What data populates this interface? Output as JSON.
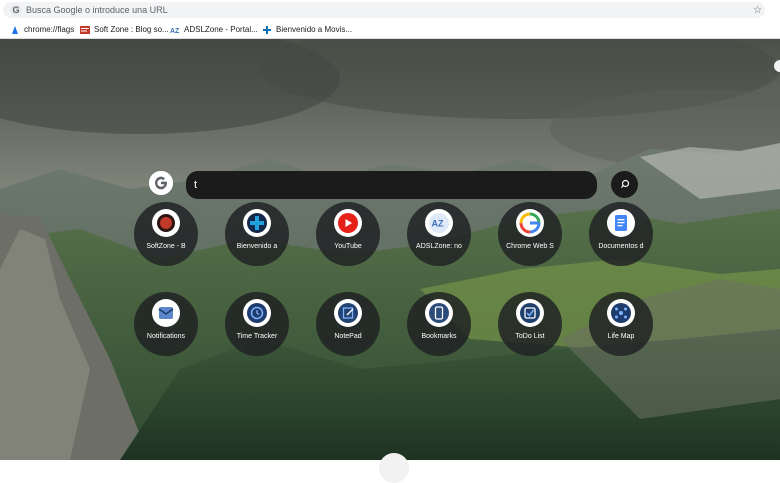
{
  "omnibox": {
    "placeholder": "Busca Google o introduce una URL",
    "icon": "google-g-icon"
  },
  "bookmarks": [
    {
      "label": "chrome://flags",
      "icon": "chrome-flags-icon",
      "color": "#1a73e8"
    },
    {
      "label": "Soft Zone : Blog so...",
      "icon": "softzone-icon",
      "color": "#c0392b"
    },
    {
      "label": "ADSLZone - Portal...",
      "icon": "adslzone-icon",
      "color": "#3d6fb6"
    },
    {
      "label": "Bienvenido a Movis...",
      "icon": "movistar-icon",
      "color": "#0b6fb8"
    }
  ],
  "search": {
    "value": "t"
  },
  "shortcuts": [
    {
      "label": "SoftZone - B",
      "icon": "softzone-icon",
      "color": "#c0392b"
    },
    {
      "label": "Bienvenido a",
      "icon": "movistar-icon",
      "color": "#0b6fb8"
    },
    {
      "label": "YouTube",
      "icon": "youtube-icon",
      "color": "#e62117"
    },
    {
      "label": "ADSLZone: no",
      "icon": "adslzone-icon",
      "color": "#3d6fb6"
    },
    {
      "label": "Chrome Web S",
      "icon": "chrome-web-store-icon",
      "color": "#4285f4"
    },
    {
      "label": "Documentos d",
      "icon": "google-docs-icon",
      "color": "#4285f4"
    },
    {
      "label": "Notifications",
      "icon": "notifications-icon",
      "color": "#5b86c9"
    },
    {
      "label": "Time Tracker",
      "icon": "time-tracker-icon",
      "color": "#1e3b6e"
    },
    {
      "label": "NotePad",
      "icon": "notepad-icon",
      "color": "#22426f"
    },
    {
      "label": "Bookmarks",
      "icon": "bookmarks-icon",
      "color": "#2c4d7a"
    },
    {
      "label": "ToDo List",
      "icon": "todo-list-icon",
      "color": "#1f3f6d"
    },
    {
      "label": "Life Map",
      "icon": "life-map-icon",
      "color": "#1e3b6e"
    }
  ]
}
